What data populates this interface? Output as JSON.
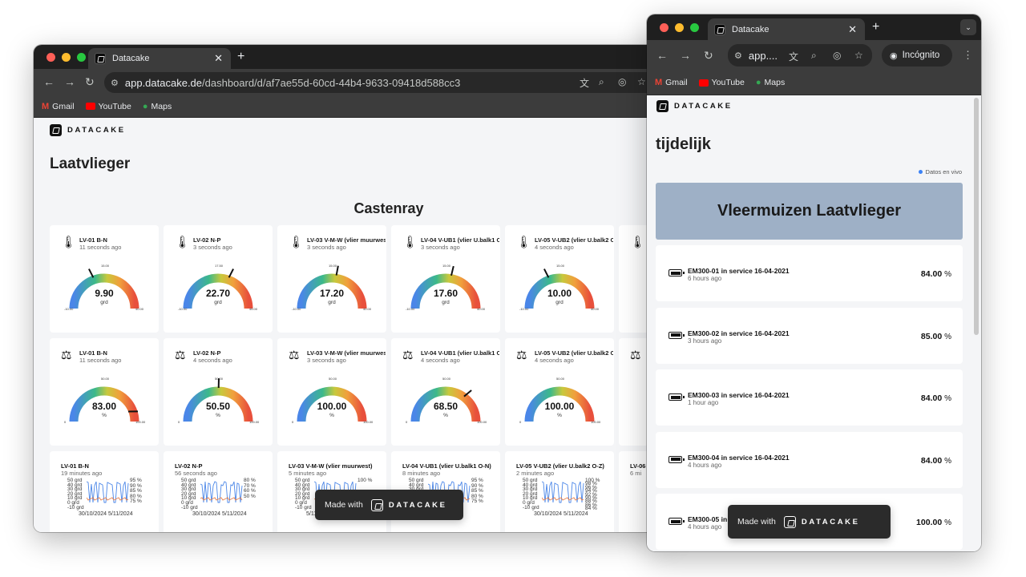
{
  "colors": {
    "tabstrip": "#1f1f1f",
    "toolbar": "#3c3c3c",
    "page_bg": "#f4f5f7",
    "banner": "#9eb0c6",
    "live_dot": "#3b82f6"
  },
  "window_left": {
    "tab_title": "Datacake",
    "url_host": "app.datacake.de",
    "url_path": "/dashboard/d/af7ae55d-60cd-44b4-9633-09418d588cc3",
    "bookmarks": [
      "Gmail",
      "YouTube",
      "Maps"
    ],
    "logo_text": "DATACAKE",
    "page_title": "Laatvlieger",
    "section_title": "Castenray",
    "temp_cards": [
      {
        "title": "LV-01 B-N",
        "sub": "11 seconds ago",
        "value": "9.90",
        "unit": "grd",
        "min": "-10.00",
        "mid": "15.00",
        "max": "40.00",
        "frac": 0.4
      },
      {
        "title": "LV-02 N-P",
        "sub": "3 seconds ago",
        "value": "22.70",
        "unit": "grd",
        "min": "-10.00",
        "mid": "17.50",
        "max": "45.00",
        "frac": 0.6
      },
      {
        "title": "LV-03 V-M-W (vlier muurwest)",
        "sub": "3 seconds ago",
        "value": "17.20",
        "unit": "grd",
        "min": "-10.00",
        "mid": "15.00",
        "max": "40.00",
        "frac": 0.54
      },
      {
        "title": "LV-04 V-UB1 (vlier U.balk1 O-N)",
        "sub": "3 seconds ago",
        "value": "17.60",
        "unit": "grd",
        "min": "-10.00",
        "mid": "15.00",
        "max": "40.00",
        "frac": 0.55
      },
      {
        "title": "LV-05 V-UB2 (vlier U.balk2 O-Z)",
        "sub": "4 seconds ago",
        "value": "10.00",
        "unit": "grd",
        "min": "-10.00",
        "mid": "15.00",
        "max": "40.00",
        "frac": 0.4
      }
    ],
    "hum_cards": [
      {
        "title": "LV-01 B-N",
        "sub": "11 seconds ago",
        "value": "83.00",
        "unit": "%",
        "min": "0",
        "mid": "50.00",
        "max": "100.00",
        "frac": 0.83
      },
      {
        "title": "LV-02 N-P",
        "sub": "4 seconds ago",
        "value": "50.50",
        "unit": "%",
        "min": "0",
        "mid": "50.00",
        "max": "100.00",
        "frac": 0.505
      },
      {
        "title": "LV-03 V-M-W (vlier muurwest)",
        "sub": "3 seconds ago",
        "value": "100.00",
        "unit": "%",
        "min": "0",
        "mid": "50.00",
        "max": "100.00",
        "frac": 1.0
      },
      {
        "title": "LV-04 V-UB1 (vlier U.balk1 O-N)",
        "sub": "4 seconds ago",
        "value": "68.50",
        "unit": "%",
        "min": "0",
        "mid": "50.00",
        "max": "100.00",
        "frac": 0.685
      },
      {
        "title": "LV-05 V-UB2 (vlier U.balk2 O-Z)",
        "sub": "4 seconds ago",
        "value": "100.00",
        "unit": "%",
        "min": "0",
        "mid": "50.00",
        "max": "100.00",
        "frac": 1.0
      }
    ],
    "chart_cards": [
      {
        "title": "LV-01 B-N",
        "sub": "19 minutes ago",
        "left_ticks": [
          "50 grd",
          "40 grd",
          "30 grd",
          "20 grd",
          "10 grd",
          "0 grd",
          "-10 grd"
        ],
        "right_ticks": [
          "95 %",
          "90 %",
          "85 %",
          "80 %",
          "75 %"
        ],
        "dates": "30/10/2024 5/11/2024"
      },
      {
        "title": "LV-02 N-P",
        "sub": "56 seconds ago",
        "left_ticks": [
          "50 grd",
          "40 grd",
          "30 grd",
          "20 grd",
          "10 grd",
          "0 grd",
          "-10 grd"
        ],
        "right_ticks": [
          "80 %",
          "70 %",
          "60 %",
          "50 %"
        ],
        "dates": "30/10/2024 5/11/2024"
      },
      {
        "title": "LV-03 V-M-W (vlier muurwest)",
        "sub": "5 minutes ago",
        "left_ticks": [
          "50 grd",
          "40 grd",
          "30 grd",
          "20 grd",
          "10 grd",
          "0 grd",
          "-10 grd"
        ],
        "right_ticks": [
          "100 %"
        ],
        "dates": "5/11/2024"
      },
      {
        "title": "LV-04 V-UB1 (vlier U.balk1 O-N)",
        "sub": "8 minutes ago",
        "left_ticks": [
          "50 grd",
          "40 grd",
          "30 grd",
          "20 grd",
          "10 grd",
          "0 grd",
          "-10 grd"
        ],
        "right_ticks": [
          "95 %",
          "90 %",
          "85 %",
          "80 %",
          "75 %"
        ],
        "dates": ""
      },
      {
        "title": "LV-05 V-UB2 (vlier U.balk2 O-Z)",
        "sub": "2 minutes ago",
        "left_ticks": [
          "50 grd",
          "40 grd",
          "30 grd",
          "20 grd",
          "10 grd",
          "0 grd",
          "-10 grd"
        ],
        "right_ticks": [
          "100 %",
          "98 %",
          "96 %",
          "94 %",
          "92 %",
          "90 %",
          "88 %",
          "86 %",
          "84 %"
        ],
        "dates": "30/10/2024 5/11/2024"
      },
      {
        "title": "LV-06",
        "sub": "6 mi",
        "left_ticks": [],
        "right_ticks": [],
        "dates": ""
      }
    ],
    "made_with": "Made with"
  },
  "window_right": {
    "tab_title": "Datacake",
    "url_short": "app....",
    "incognito_label": "Incógnito",
    "bookmarks": [
      "Gmail",
      "YouTube",
      "Maps"
    ],
    "logo_text": "DATACAKE",
    "page_title": "tijdelijk",
    "live_label": "Datos en vivo",
    "banner_title": "Vleermuizen Laatvlieger",
    "rows": [
      {
        "title": "EM300-01 in service 16-04-2021",
        "sub": "6 hours ago",
        "value": "84.00",
        "unit": "%"
      },
      {
        "title": "EM300-02 in service 16-04-2021",
        "sub": "3 hours ago",
        "value": "85.00",
        "unit": "%"
      },
      {
        "title": "EM300-03 in service 16-04-2021",
        "sub": "1 hour ago",
        "value": "84.00",
        "unit": "%"
      },
      {
        "title": "EM300-04 in service 16-04-2021",
        "sub": "4 hours ago",
        "value": "84.00",
        "unit": "%"
      },
      {
        "title": "EM300-05 in",
        "sub": "4 hours ago",
        "value": "100.00",
        "unit": "%"
      }
    ],
    "made_with": "Made with"
  }
}
